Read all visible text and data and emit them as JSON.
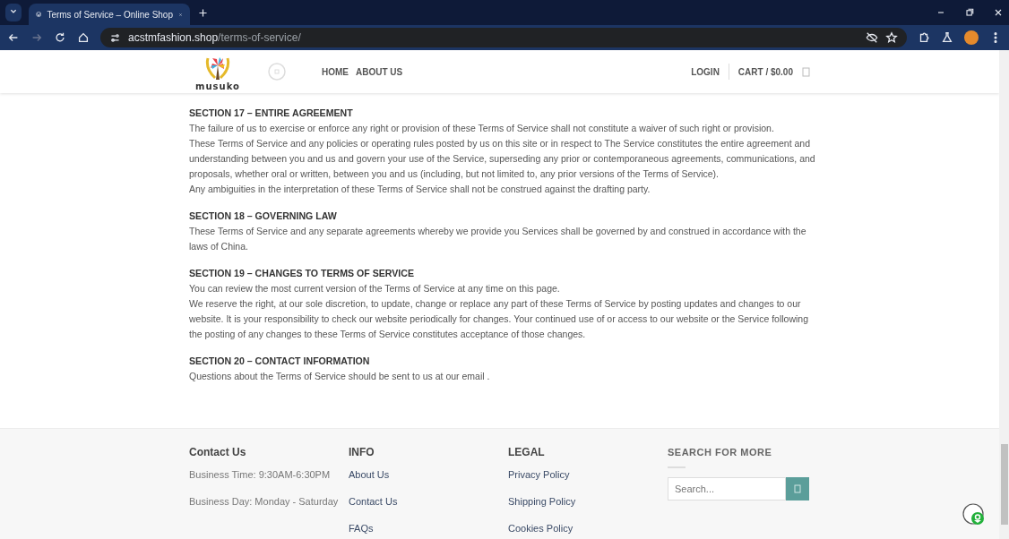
{
  "browser": {
    "tab_title": "Terms of Service – Online Shop",
    "url_domain": "acstmfashion.shop",
    "url_path": "/terms-of-service/"
  },
  "header": {
    "logo_text": "musuko",
    "nav": [
      "HOME",
      "ABOUT US"
    ],
    "login": "LOGIN",
    "cart": "CART / $0.00"
  },
  "sections": [
    {
      "heading": "SECTION 17 – ENTIRE AGREEMENT",
      "paragraphs": [
        "The failure of us to exercise or enforce any right or provision of these Terms of Service shall not constitute a waiver of such right or provision.",
        "These Terms of Service and any policies or operating rules posted by us on this site or in respect to The Service constitutes the entire agreement and understanding between you and us and govern your use of the Service, superseding any prior or contemporaneous agreements, communications, and proposals, whether oral or written, between you and us (including, but not limited to, any prior versions of the Terms of Service).",
        "Any ambiguities in the interpretation of these Terms of Service shall not be construed against the drafting party."
      ]
    },
    {
      "heading": "SECTION 18 – GOVERNING LAW",
      "paragraphs": [
        "These Terms of Service and any separate agreements whereby we provide you Services shall be governed by and construed in accordance with the laws of China."
      ]
    },
    {
      "heading": "SECTION 19 – CHANGES TO TERMS OF SERVICE",
      "paragraphs": [
        "You can review the most current version of the Terms of Service at any time on this page.",
        "We reserve the right, at our sole discretion, to update, change or replace any part of these Terms of Service by posting updates and changes to our website. It is your responsibility to check our website periodically for changes. Your continued use of or access to our website or the Service following the posting of any changes to these Terms of Service constitutes acceptance of those changes."
      ]
    },
    {
      "heading": "SECTION 20 – CONTACT INFORMATION",
      "paragraphs": [
        "Questions about the Terms of Service should be sent to us at our email ."
      ]
    }
  ],
  "footer": {
    "columns": [
      {
        "kind": "text",
        "heading": "Contact Us",
        "items": [
          "Business Time: 9:30AM-6:30PM",
          "Business Day: Monday - Saturday"
        ]
      },
      {
        "kind": "links",
        "heading": "INFO",
        "items": [
          "About Us",
          "Contact Us",
          "FAQs"
        ]
      },
      {
        "kind": "links",
        "heading": "LEGAL",
        "items": [
          "Privacy Policy",
          "Shipping Policy",
          "Cookies Policy"
        ]
      },
      {
        "kind": "search",
        "heading": "SEARCH FOR MORE",
        "placeholder": "Search..."
      }
    ]
  }
}
